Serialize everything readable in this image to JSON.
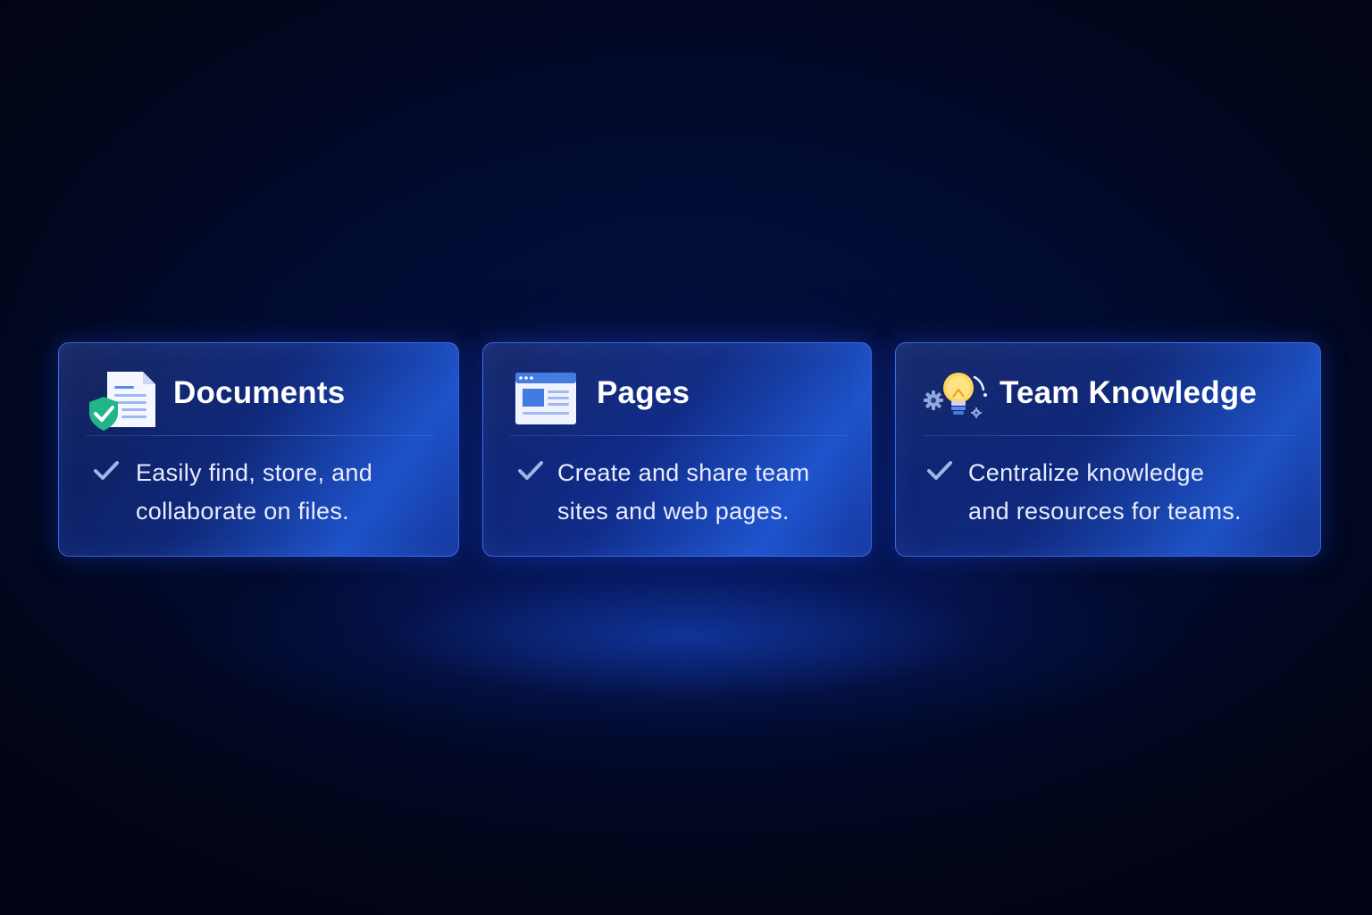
{
  "cards": [
    {
      "title": "Documents",
      "icon": "document-shield-icon",
      "description_lines": [
        "Easily find, store, and",
        "collaborate on files."
      ]
    },
    {
      "title": "Pages",
      "icon": "web-page-icon",
      "description_lines": [
        "Create and share team",
        "sites and web pages."
      ]
    },
    {
      "title": "Team Knowledge",
      "icon": "lightbulb-gears-icon",
      "description_lines": [
        "Centralize knowledge",
        "and resources for teams."
      ]
    }
  ],
  "colors": {
    "background": "#020a2c",
    "card_border": "#4678ff",
    "check": "#9fb6e8",
    "shield": "#1db386"
  }
}
